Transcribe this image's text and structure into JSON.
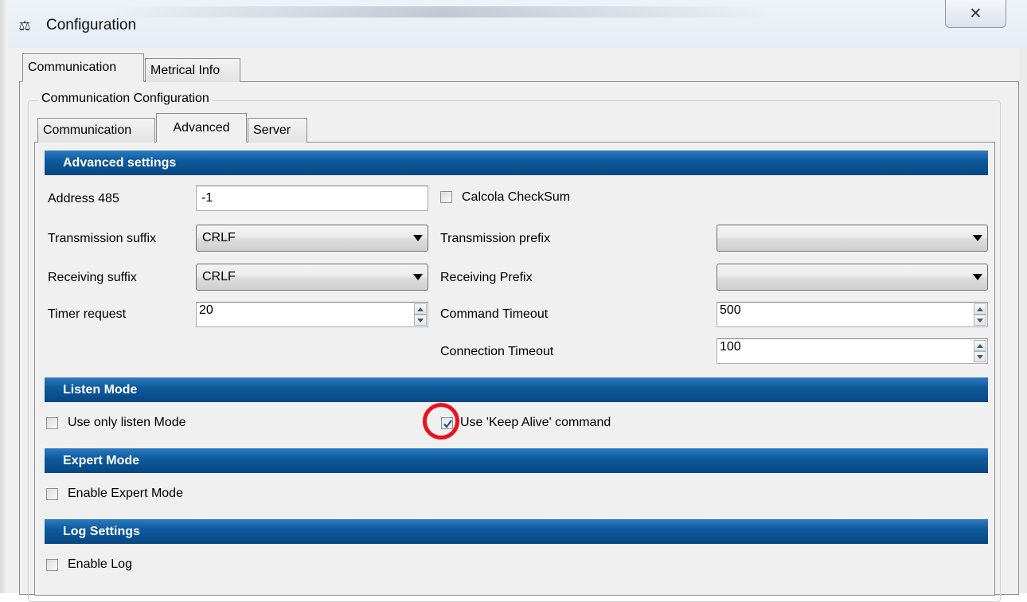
{
  "window": {
    "title": "Configuration",
    "icon": "scale-icon",
    "close_symbol": "✕"
  },
  "main_tabs": [
    {
      "label": "Communication",
      "selected": true
    },
    {
      "label": "Metrical Info",
      "selected": false
    }
  ],
  "groupbox": {
    "title": "Communication Configuration"
  },
  "sub_tabs": [
    {
      "label": "Communication",
      "selected": false
    },
    {
      "label": "Advanced",
      "selected": true
    },
    {
      "label": "Server",
      "selected": false
    }
  ],
  "advanced": {
    "header": "Advanced settings",
    "address485": {
      "label": "Address 485",
      "value": "-1"
    },
    "calcola_checksum": {
      "label": "Calcola CheckSum",
      "checked": false
    },
    "transmission_suffix": {
      "label": "Transmission suffix",
      "value": "CRLF"
    },
    "transmission_prefix": {
      "label": "Transmission prefix",
      "value": ""
    },
    "receiving_suffix": {
      "label": "Receiving suffix",
      "value": "CRLF"
    },
    "receiving_prefix": {
      "label": "Receiving Prefix",
      "value": ""
    },
    "timer_request": {
      "label": "Timer request",
      "value": "20"
    },
    "command_timeout": {
      "label": "Command Timeout",
      "value": "500"
    },
    "connection_timeout": {
      "label": "Connection Timeout",
      "value": "100"
    }
  },
  "listen": {
    "header": "Listen Mode",
    "use_only_listen": {
      "label": "Use only listen Mode",
      "checked": false
    },
    "keep_alive": {
      "label": "Use 'Keep Alive' command",
      "checked": true
    }
  },
  "expert": {
    "header": "Expert Mode",
    "enable_expert": {
      "label": "Enable Expert Mode",
      "checked": false
    }
  },
  "log": {
    "header": "Log Settings",
    "enable_log": {
      "label": "Enable Log",
      "checked": false
    }
  },
  "colors": {
    "section_header": "#0f5a9c",
    "highlight": "#e8131e"
  }
}
